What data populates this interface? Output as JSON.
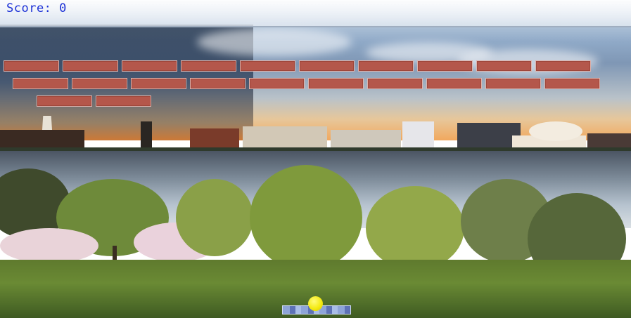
{
  "hud": {
    "score_label": "Score:",
    "score_value": "0"
  },
  "bricks": {
    "rows": [
      {
        "count": 10
      },
      {
        "count": 10
      },
      {
        "count": 2
      }
    ],
    "color": "#b4574b"
  },
  "ball": {
    "color": "#f4ea12"
  },
  "paddle": {
    "color": "#6f86c4"
  },
  "background": {
    "description_color_sky": "#8fa9c7"
  }
}
